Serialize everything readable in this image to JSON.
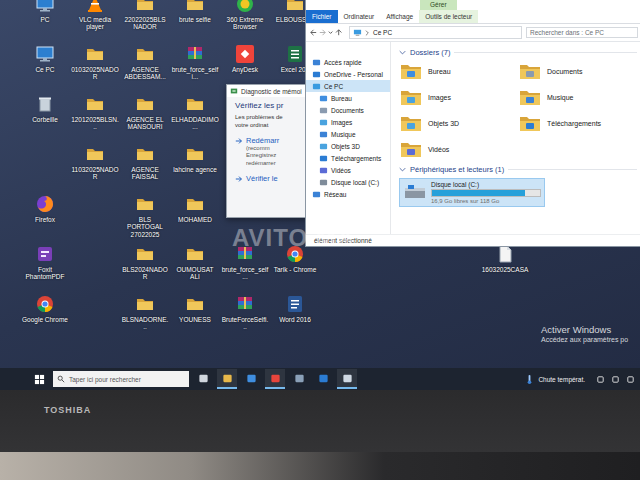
{
  "desktop": {
    "icons": [
      {
        "label": "PC",
        "kind": "pc"
      },
      {
        "label": "Ce PC",
        "kind": "pc"
      },
      {
        "label": "Corbeille",
        "kind": "bin"
      },
      {
        "label": "Firefox",
        "kind": "firefox"
      },
      {
        "label": "Foxit PhantomPDF",
        "kind": "pdf"
      },
      {
        "label": "Google Chrome",
        "kind": "chrome"
      },
      {
        "label": "VLC media player",
        "kind": "vlc"
      },
      {
        "label": "01032025NADOR",
        "kind": "folder"
      },
      {
        "label": "12012025BLSN...",
        "kind": "folder"
      },
      {
        "label": "11032025NADOR",
        "kind": "folder"
      },
      {
        "label": "22022025BLS NADOR",
        "kind": "folder"
      },
      {
        "label": "AGENCE ABDESSAM...",
        "kind": "folder"
      },
      {
        "label": "AGENCE EL MANSOURI",
        "kind": "folder"
      },
      {
        "label": "AGENCE FAISSAL",
        "kind": "folder"
      },
      {
        "label": "BLS PORTOGAL 27022025",
        "kind": "folder"
      },
      {
        "label": "BLS2024NADOR",
        "kind": "folder"
      },
      {
        "label": "BLSNADORNE...",
        "kind": "folder"
      },
      {
        "label": "brute selfie",
        "kind": "folder"
      },
      {
        "label": "brute_force_selfi...",
        "kind": "archive"
      },
      {
        "label": "ELHADDADIMO...",
        "kind": "folder"
      },
      {
        "label": "lahcine agence",
        "kind": "folder"
      },
      {
        "label": "MOHAMED",
        "kind": "folder"
      },
      {
        "label": "OUMOUSAT ALI",
        "kind": "folder"
      },
      {
        "label": "YOUNESS",
        "kind": "folder"
      },
      {
        "label": "360 Extreme Browser",
        "kind": "browser"
      },
      {
        "label": "AnyDesk",
        "kind": "anydesk"
      },
      {
        "label": "brute_force_self...",
        "kind": "archive"
      },
      {
        "label": "BruteForceSelfi...",
        "kind": "archive"
      },
      {
        "label": "ELBOUSSTA",
        "kind": "folder"
      },
      {
        "label": "Excel 201",
        "kind": "excel"
      },
      {
        "label": "Tarik - Chrome",
        "kind": "chrome"
      },
      {
        "label": "Word 2016",
        "kind": "word"
      },
      {
        "label": "16032025CASA",
        "kind": "file"
      }
    ]
  },
  "watermark": "AVITO.MA",
  "activation": {
    "title": "Activer Windows",
    "subtitle": "Accédez aux paramètres po"
  },
  "dialog": {
    "title": "Diagnostic de mémoi",
    "heading": "Vérifiez les pr",
    "body": [
      "Les problèmes de",
      "votre ordinat"
    ],
    "options": [
      {
        "title": "Redémarr",
        "lines": [
          "(recomm",
          "Enregistrez",
          "redémarrer"
        ]
      },
      {
        "title": "Vérifier le",
        "lines": []
      }
    ]
  },
  "explorer": {
    "context_tab": "Gérer",
    "tabs": [
      {
        "label": "Fichier",
        "kind": "menu",
        "selected": false
      },
      {
        "label": "Ordinateur",
        "kind": "tab",
        "selected": false
      },
      {
        "label": "Affichage",
        "kind": "tab",
        "selected": false
      },
      {
        "label": "Outils de lecteur",
        "kind": "context",
        "selected": false
      }
    ],
    "address": "Ce PC",
    "search": {
      "placeholder": "Rechercher dans : Ce PC"
    },
    "nav": [
      {
        "label": "Accès rapide",
        "kind": "star",
        "indent": false,
        "selected": false
      },
      {
        "label": "OneDrive - Personal",
        "kind": "cloud",
        "indent": false,
        "selected": false
      },
      {
        "label": "Ce PC",
        "kind": "pc",
        "indent": false,
        "selected": true
      },
      {
        "label": "Bureau",
        "kind": "desktop",
        "indent": true,
        "selected": false
      },
      {
        "label": "Documents",
        "kind": "documents",
        "indent": true,
        "selected": false
      },
      {
        "label": "Images",
        "kind": "images",
        "indent": true,
        "selected": false
      },
      {
        "label": "Musique",
        "kind": "music",
        "indent": true,
        "selected": false
      },
      {
        "label": "Objets 3D",
        "kind": "objects",
        "indent": true,
        "selected": false
      },
      {
        "label": "Téléchargements",
        "kind": "downloads",
        "indent": true,
        "selected": false
      },
      {
        "label": "Vidéos",
        "kind": "videos",
        "indent": true,
        "selected": false
      },
      {
        "label": "Disque local (C:)",
        "kind": "drive",
        "indent": true,
        "selected": false
      },
      {
        "label": "Réseau",
        "kind": "network",
        "indent": false,
        "selected": false
      }
    ],
    "folders": {
      "title": "Dossiers (7)",
      "items": [
        {
          "label": "Bureau",
          "kind": "desktop"
        },
        {
          "label": "Documents",
          "kind": "documents"
        },
        {
          "label": "Images",
          "kind": "images"
        },
        {
          "label": "Musique",
          "kind": "music"
        },
        {
          "label": "Objets 3D",
          "kind": "objects"
        },
        {
          "label": "Téléchargements",
          "kind": "downloads"
        },
        {
          "label": "Vidéos",
          "kind": "videos"
        }
      ]
    },
    "drives": {
      "title": "Périphériques et lecteurs (1)",
      "items": [
        {
          "label": "Disque local (C:)",
          "free": "16,9 Go libres sur 118 Go",
          "level": 0.86,
          "selected": true
        }
      ]
    },
    "status_bar": "élément sélectionné"
  },
  "taskbar": {
    "search": {
      "placeholder": "Taper ici pour rechercher"
    },
    "apps": [
      {
        "kind": "taskview",
        "open": false
      },
      {
        "kind": "explorer",
        "open": true
      },
      {
        "kind": "store",
        "open": false
      },
      {
        "kind": "chrome",
        "open": true
      },
      {
        "kind": "media",
        "open": false
      },
      {
        "kind": "mail",
        "open": false
      },
      {
        "kind": "app",
        "open": true
      }
    ],
    "weather": "Chute températ.",
    "tray": [
      {
        "kind": "people"
      },
      {
        "kind": "network"
      },
      {
        "kind": "volume"
      }
    ]
  },
  "bezel": {
    "brand": "TOSHIBA"
  }
}
